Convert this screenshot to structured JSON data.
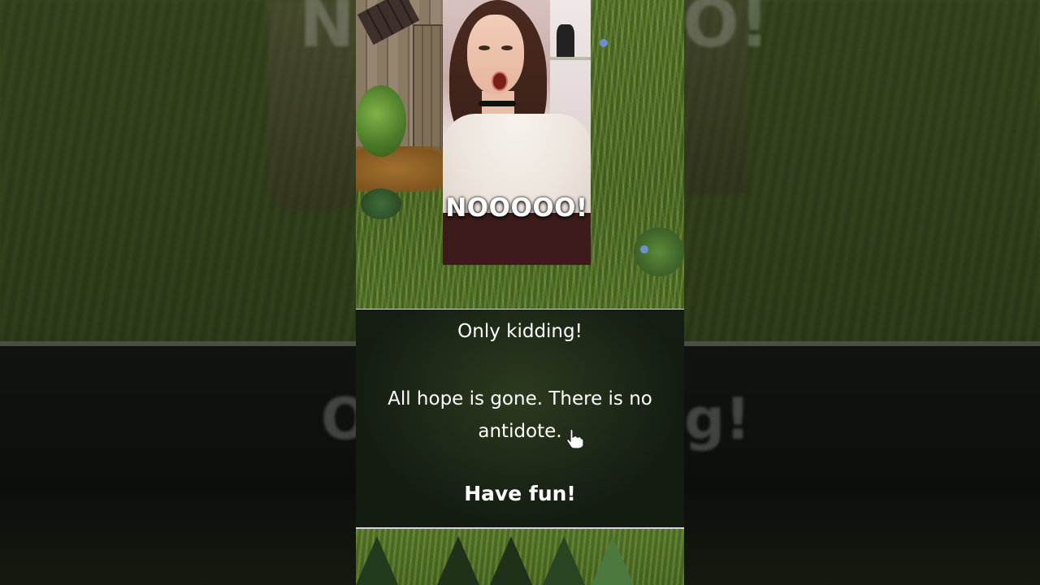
{
  "background": {
    "ghost_text_top_left": "N",
    "ghost_text_top_right": "O!",
    "ghost_text_bottom_left": "O",
    "ghost_text_bottom_right": "g!"
  },
  "webcam": {
    "caption": "NOOOOO!"
  },
  "dialog": {
    "line1": "Only kidding!",
    "line2": "All hope is gone. There is no antidote.",
    "line3": "Have fun!"
  },
  "icons": {
    "cursor": "hand-pointer-icon"
  },
  "colors": {
    "dialog_text": "#ffffff",
    "caption_text": "#ffffff",
    "grass": "#5a7a2c"
  }
}
